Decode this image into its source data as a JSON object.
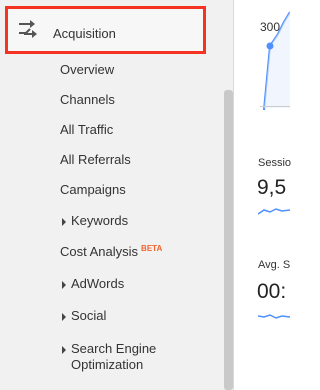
{
  "sidebar": {
    "acquisition_label": "Acquisition",
    "items": [
      {
        "label": "Overview",
        "expandable": false
      },
      {
        "label": "Channels",
        "expandable": false
      },
      {
        "label": "All Traffic",
        "expandable": false
      },
      {
        "label": "All Referrals",
        "expandable": false
      },
      {
        "label": "Campaigns",
        "expandable": false
      },
      {
        "label": "Keywords",
        "expandable": true
      },
      {
        "label": "Cost Analysis",
        "badge": "BETA",
        "expandable": false
      },
      {
        "label": "AdWords",
        "expandable": true
      },
      {
        "label": "Social",
        "expandable": true
      },
      {
        "label": "Search Engine Optimization",
        "line1": "Search Engine",
        "line2": "Optimization",
        "expandable": true
      }
    ]
  },
  "chart": {
    "tick_label": "300"
  },
  "metrics": [
    {
      "label": "Sessio",
      "value": "9,5"
    },
    {
      "label": "Avg. S",
      "value": "00:"
    }
  ],
  "colors": {
    "highlight_border": "#f53322",
    "line_color": "#4d90fe",
    "beta_color": "#f0642e"
  }
}
